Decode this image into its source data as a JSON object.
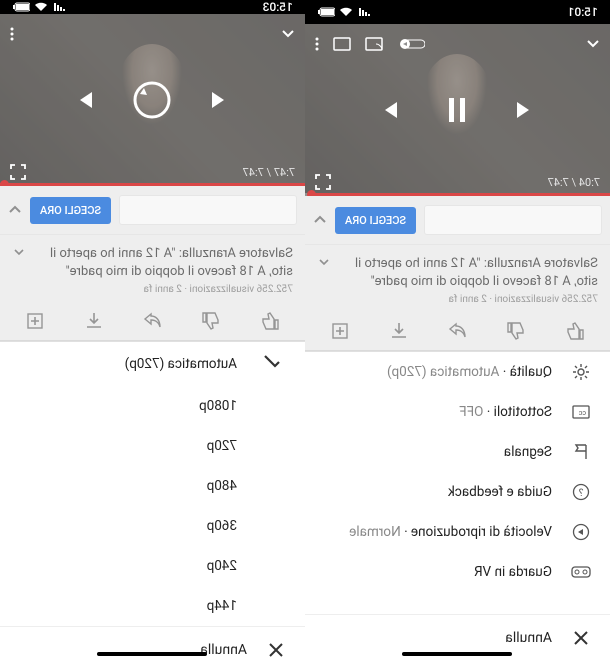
{
  "statusbar": {
    "left_time": "15:01",
    "right_time": "15:03",
    "wifi": "wifi-icon",
    "signal": "signal-icon",
    "battery": "battery-icon"
  },
  "player": {
    "time_left": "7:04 / 7:47",
    "time_right": "7:47 / 7:47"
  },
  "banner": {
    "cta": "SCEGLI ORA"
  },
  "video": {
    "title": "Salvatore Aranzulla: \"A 12 anni ho aperto il sito, A 18 facevo il doppio di mio padre\"",
    "meta": "752.256 visualizzazioni · 2 anni fa"
  },
  "settings_menu": {
    "quality_label": "Qualità",
    "quality_value": "Automatica (720p)",
    "captions_label": "Sottotitoli",
    "captions_value": "OFF",
    "report": "Segnala",
    "help": "Guida e feedback",
    "speed_label": "Velocità di riproduzione",
    "speed_value": "Normale",
    "vr": "Guarda in VR",
    "cancel": "Annulla"
  },
  "quality_menu": {
    "auto": "Automatica (720p)",
    "options": [
      "1080p",
      "720p",
      "480p",
      "360p",
      "240p",
      "144p"
    ],
    "cancel": "Annulla"
  }
}
